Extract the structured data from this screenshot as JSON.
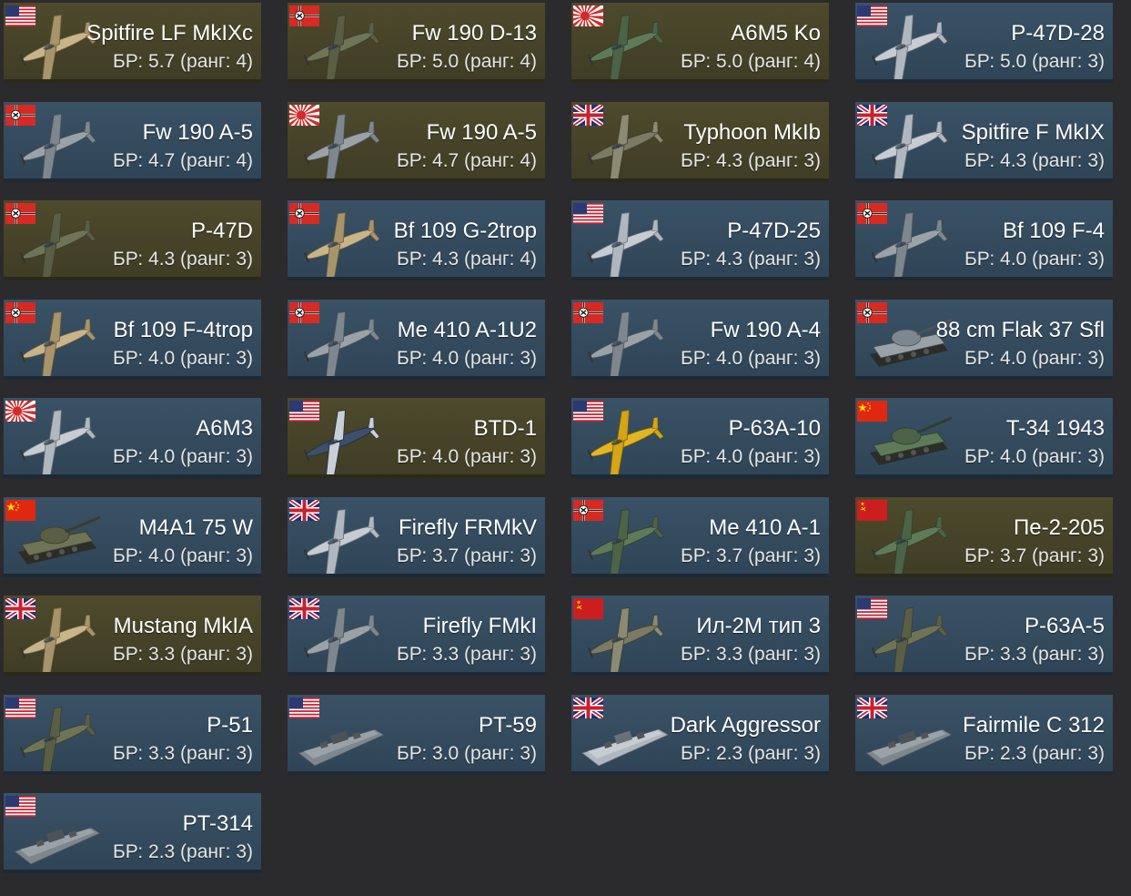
{
  "colors": {
    "background": "#2b2a2d",
    "card_normal": "#33495c",
    "card_premium": "#474329"
  },
  "vehicles": [
    {
      "name": "Spitfire LF MkIXc",
      "br": "БР: 5.7 (ранг: 4)",
      "flag": "usa",
      "type": "plane",
      "scheme": "tan",
      "premium": true
    },
    {
      "name": "Fw 190 D-13",
      "br": "БР: 5.0 (ранг: 4)",
      "flag": "germany",
      "type": "plane",
      "scheme": "olive",
      "premium": true
    },
    {
      "name": "A6M5 Ko",
      "br": "БР: 5.0 (ранг: 4)",
      "flag": "japan",
      "type": "plane",
      "scheme": "green",
      "premium": true
    },
    {
      "name": "P-47D-28",
      "br": "БР: 5.0 (ранг: 3)",
      "flag": "usa",
      "type": "plane",
      "scheme": "silver",
      "premium": false
    },
    {
      "name": "Fw 190 A-5",
      "br": "БР: 4.7 (ранг: 4)",
      "flag": "germany",
      "type": "plane",
      "scheme": "grey",
      "premium": false
    },
    {
      "name": "Fw 190 A-5",
      "br": "БР: 4.7 (ранг: 4)",
      "flag": "japan",
      "type": "plane",
      "scheme": "grey",
      "premium": true
    },
    {
      "name": "Typhoon MkIb",
      "br": "БР: 4.3 (ранг: 3)",
      "flag": "uk",
      "type": "plane",
      "scheme": "camo",
      "premium": true
    },
    {
      "name": "Spitfire F MkIX",
      "br": "БР: 4.3 (ранг: 3)",
      "flag": "uk",
      "type": "plane",
      "scheme": "silver",
      "premium": false
    },
    {
      "name": "P-47D",
      "br": "БР: 4.3 (ранг: 3)",
      "flag": "germany",
      "type": "plane",
      "scheme": "olive",
      "premium": true
    },
    {
      "name": "Bf 109 G-2trop",
      "br": "БР: 4.3 (ранг: 4)",
      "flag": "germany",
      "type": "plane",
      "scheme": "tan",
      "premium": false
    },
    {
      "name": "P-47D-25",
      "br": "БР: 4.3 (ранг: 3)",
      "flag": "usa",
      "type": "plane",
      "scheme": "silver",
      "premium": false
    },
    {
      "name": "Bf 109 F-4",
      "br": "БР: 4.0 (ранг: 3)",
      "flag": "germany",
      "type": "plane",
      "scheme": "grey",
      "premium": false
    },
    {
      "name": "Bf 109 F-4trop",
      "br": "БР: 4.0 (ранг: 3)",
      "flag": "germany",
      "type": "plane",
      "scheme": "tan",
      "premium": false
    },
    {
      "name": "Me 410 A-1U2",
      "br": "БР: 4.0 (ранг: 3)",
      "flag": "germany",
      "type": "plane",
      "scheme": "grey",
      "premium": false
    },
    {
      "name": "Fw 190 A-4",
      "br": "БР: 4.0 (ранг: 3)",
      "flag": "germany",
      "type": "plane",
      "scheme": "grey",
      "premium": false
    },
    {
      "name": "88 cm Flak 37 Sfl",
      "br": "БР: 4.0 (ранг: 3)",
      "flag": "germany",
      "type": "tank",
      "scheme": "grey",
      "premium": false
    },
    {
      "name": "A6M3",
      "br": "БР: 4.0 (ранг: 3)",
      "flag": "japan",
      "type": "plane",
      "scheme": "silver",
      "premium": false
    },
    {
      "name": "BTD-1",
      "br": "БР: 4.0 (ранг: 3)",
      "flag": "usa",
      "type": "plane",
      "scheme": "navy",
      "premium": true
    },
    {
      "name": "P-63A-10",
      "br": "БР: 4.0 (ранг: 3)",
      "flag": "usa",
      "type": "plane",
      "scheme": "yellow",
      "premium": false
    },
    {
      "name": "T-34 1943",
      "br": "БР: 4.0 (ранг: 3)",
      "flag": "china",
      "type": "tank",
      "scheme": "green",
      "premium": false
    },
    {
      "name": "M4A1 75 W",
      "br": "БР: 4.0 (ранг: 3)",
      "flag": "china",
      "type": "tank",
      "scheme": "olive",
      "premium": false
    },
    {
      "name": "Firefly FRMkV",
      "br": "БР: 3.7 (ранг: 3)",
      "flag": "uk",
      "type": "plane",
      "scheme": "silver",
      "premium": false
    },
    {
      "name": "Me 410 A-1",
      "br": "БР: 3.7 (ранг: 3)",
      "flag": "germany",
      "type": "plane",
      "scheme": "green",
      "premium": false
    },
    {
      "name": "Пе-2-205",
      "br": "БР: 3.7 (ранг: 3)",
      "flag": "ussr",
      "type": "plane",
      "scheme": "green",
      "premium": true
    },
    {
      "name": "Mustang MkIA",
      "br": "БР: 3.3 (ранг: 3)",
      "flag": "uk",
      "type": "plane",
      "scheme": "tan",
      "premium": true
    },
    {
      "name": "Firefly FMkI",
      "br": "БР: 3.3 (ранг: 3)",
      "flag": "uk",
      "type": "plane",
      "scheme": "grey",
      "premium": false
    },
    {
      "name": "Ил-2М тип 3",
      "br": "БР: 3.3 (ранг: 3)",
      "flag": "ussr",
      "type": "plane",
      "scheme": "camo",
      "premium": false
    },
    {
      "name": "P-63A-5",
      "br": "БР: 3.3 (ранг: 3)",
      "flag": "usa",
      "type": "plane",
      "scheme": "olive",
      "premium": false
    },
    {
      "name": "P-51",
      "br": "БР: 3.3 (ранг: 3)",
      "flag": "usa",
      "type": "plane",
      "scheme": "olive",
      "premium": false
    },
    {
      "name": "PT-59",
      "br": "БР: 3.0 (ранг: 3)",
      "flag": "usa",
      "type": "boat",
      "scheme": "grey",
      "premium": false
    },
    {
      "name": "Dark Aggressor",
      "br": "БР: 2.3 (ранг: 3)",
      "flag": "uk",
      "type": "boat",
      "scheme": "silver",
      "premium": false
    },
    {
      "name": "Fairmile C 312",
      "br": "БР: 2.3 (ранг: 3)",
      "flag": "uk",
      "type": "boat",
      "scheme": "grey",
      "premium": false
    },
    {
      "name": "PT-314",
      "br": "БР: 2.3 (ранг: 3)",
      "flag": "usa",
      "type": "boat",
      "scheme": "grey",
      "premium": false
    }
  ]
}
